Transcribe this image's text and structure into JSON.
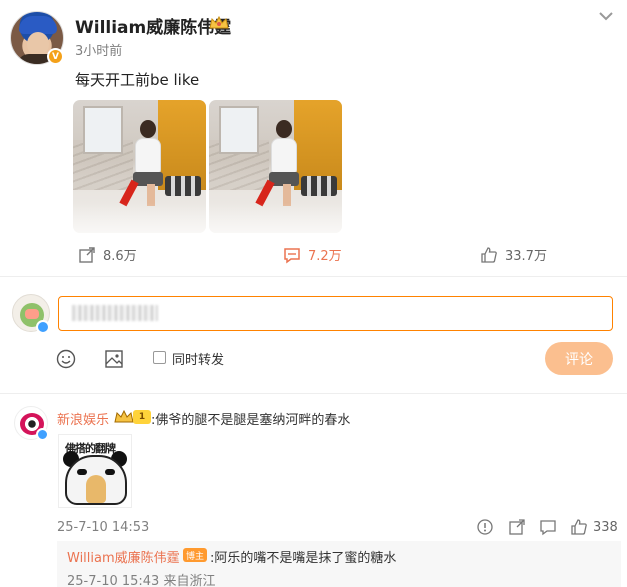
{
  "post": {
    "author": "William威廉陈伟霆",
    "time": "3小时前",
    "text": "每天开工前be like",
    "stats": {
      "reposts": "8.6万",
      "comments": "7.2万",
      "likes": "33.7万"
    }
  },
  "composer": {
    "placeholder": "",
    "repost_label": "同时转发",
    "submit_label": "评论"
  },
  "comment": {
    "author": "新浪娱乐",
    "level": "1",
    "text": ":佛爷的腿不是腿是塞纳河畔的春水",
    "sticker_caption": "佛搭的翻牌",
    "time": "25-7-10 14:53",
    "likes": "338",
    "reply": {
      "author": "William威廉陈伟霆",
      "badge": "博主",
      "text": ":阿乐的嘴不是嘴是抹了蜜的糖水",
      "meta": "25-7-10 15:43 来自浙江"
    }
  },
  "colors": {
    "accent": "#ff8200",
    "name_link": "#eb7350",
    "muted": "#808080",
    "submit_disabled": "#fbbf8f"
  },
  "icons": [
    "chevron-down-icon",
    "repost-icon",
    "comment-icon",
    "like-icon",
    "emoji-icon",
    "image-icon",
    "report-icon",
    "share-icon",
    "reply-icon"
  ]
}
